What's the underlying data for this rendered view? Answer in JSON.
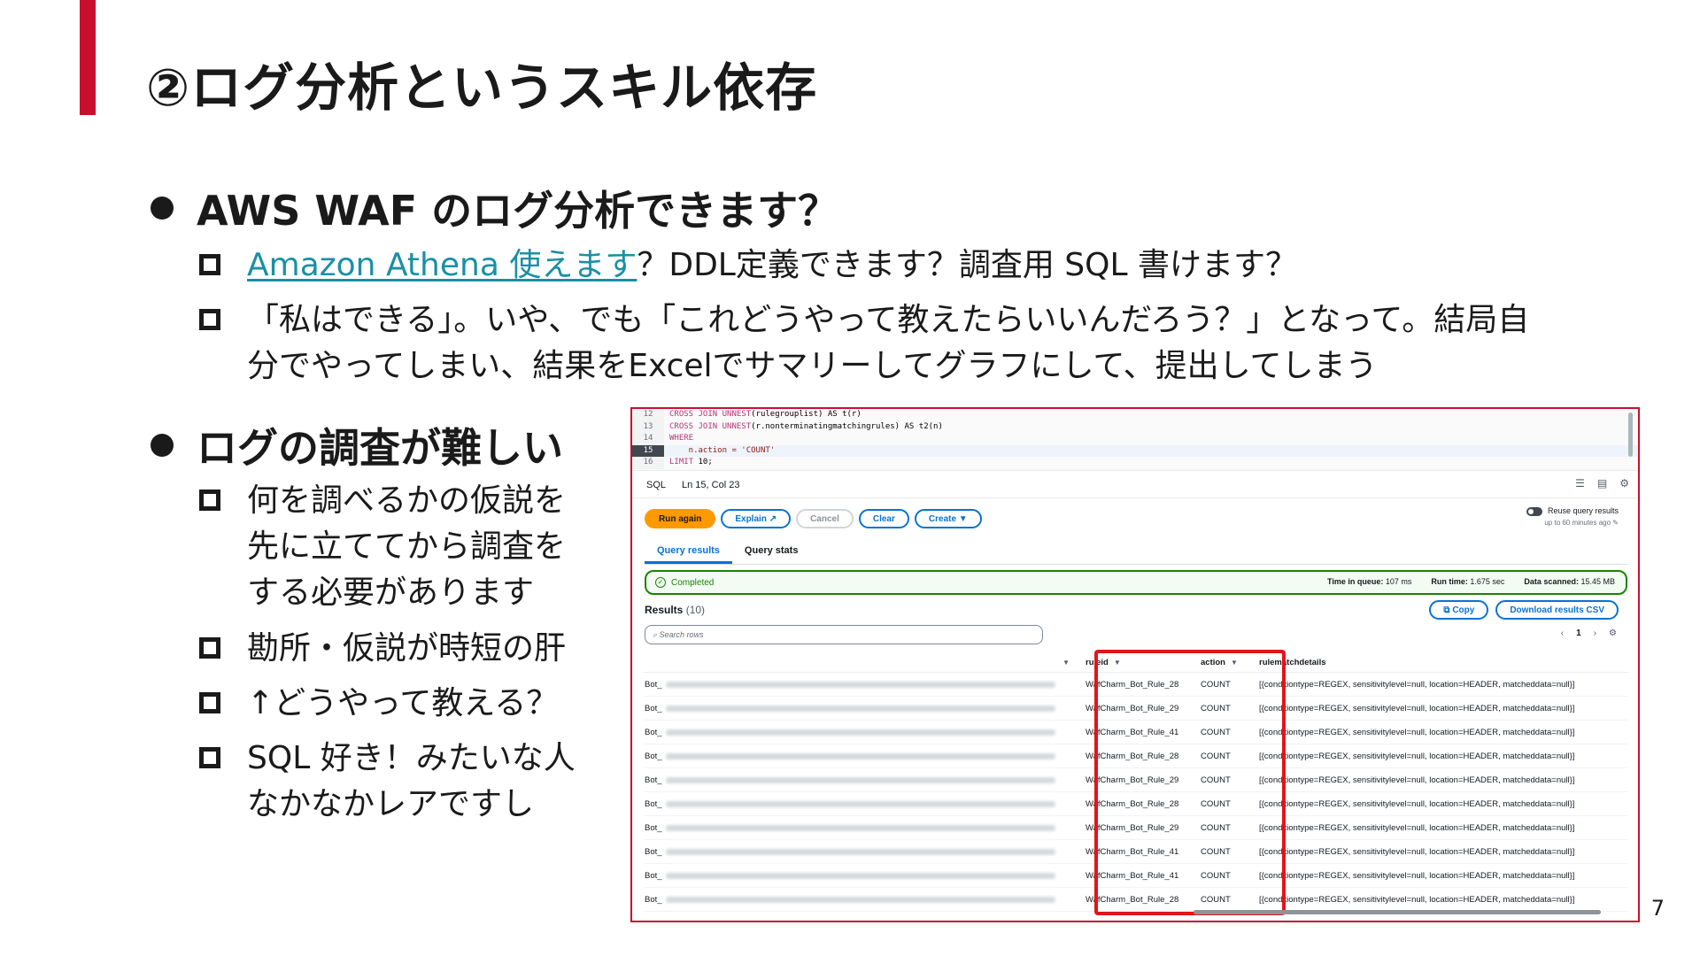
{
  "slide": {
    "title": "②ログ分析というスキル依存",
    "page_number": "7"
  },
  "bullets": [
    {
      "text": "AWS WAF のログ分析できます？",
      "subitems": [
        {
          "link": "Amazon Athena 使えます",
          "text": "？DDL定義できます？調査用 SQL 書けます？"
        },
        {
          "text": "「私はできる」。いや、でも「これどうやって教えたらいいんだろう？」となって。結局自\n分でやってしまい、結果をExcelでサマリーしてグラフにして、提出してしまう"
        }
      ]
    },
    {
      "text": "ログの調査が難しい",
      "subitems": [
        {
          "text": "何を調べるかの仮説を\n先に立ててから調査を\nする必要があります"
        },
        {
          "text": "勘所・仮説が時短の肝"
        },
        {
          "text": "↑どうやって教える？"
        },
        {
          "text": "SQL 好き！みたいな人\nなかなかレアですし"
        }
      ]
    }
  ],
  "console": {
    "sql_lines": [
      {
        "num": "12",
        "kw": "CROSS JOIN UNNEST",
        "rest": "(rulegrouplist) AS t(r)"
      },
      {
        "num": "13",
        "kw": "CROSS JOIN UNNEST",
        "rest": "(r.nonterminatingmatchingrules) AS t2(n)"
      },
      {
        "num": "14",
        "kw": "WHERE",
        "rest": ""
      },
      {
        "num": "15",
        "kw": "",
        "rest": "    n.action = 'COUNT'"
      },
      {
        "num": "16",
        "kw": "LIMIT",
        "rest": " 10;"
      }
    ],
    "status": {
      "lang": "SQL",
      "cursor": "Ln 15, Col 23"
    },
    "buttons": {
      "run_again": "Run again",
      "explain": "Explain ↗",
      "cancel": "Cancel",
      "clear": "Clear",
      "create": "Create ▼"
    },
    "reuse": {
      "label": "Reuse query results",
      "sub": "up to 60 minutes ago"
    },
    "tabs": [
      "Query results",
      "Query stats"
    ],
    "completed": {
      "label": "Completed",
      "time_in_queue_label": "Time in queue:",
      "time_in_queue": "107 ms",
      "run_time_label": "Run time:",
      "run_time": "1.675 sec",
      "data_scanned_label": "Data scanned:",
      "data_scanned": "15.45 MB"
    },
    "results": {
      "title": "Results",
      "count": "(10)",
      "copy": "Copy",
      "download": "Download results CSV",
      "search_placeholder": "Search rows",
      "page": "1"
    },
    "columns": [
      "ruleid",
      "action",
      "rulematchdetails"
    ],
    "row_prefix": "Bot_",
    "rows": [
      {
        "ruleid": "WafCharm_Bot_Rule_28",
        "action": "COUNT",
        "details": "[{conditiontype=REGEX, sensitivitylevel=null, location=HEADER, matcheddata=null}]"
      },
      {
        "ruleid": "WafCharm_Bot_Rule_29",
        "action": "COUNT",
        "details": "[{conditiontype=REGEX, sensitivitylevel=null, location=HEADER, matcheddata=null}]"
      },
      {
        "ruleid": "WafCharm_Bot_Rule_41",
        "action": "COUNT",
        "details": "[{conditiontype=REGEX, sensitivitylevel=null, location=HEADER, matcheddata=null}]"
      },
      {
        "ruleid": "WafCharm_Bot_Rule_28",
        "action": "COUNT",
        "details": "[{conditiontype=REGEX, sensitivitylevel=null, location=HEADER, matcheddata=null}]"
      },
      {
        "ruleid": "WafCharm_Bot_Rule_29",
        "action": "COUNT",
        "details": "[{conditiontype=REGEX, sensitivitylevel=null, location=HEADER, matcheddata=null}]"
      },
      {
        "ruleid": "WafCharm_Bot_Rule_28",
        "action": "COUNT",
        "details": "[{conditiontype=REGEX, sensitivitylevel=null, location=HEADER, matcheddata=null}]"
      },
      {
        "ruleid": "WafCharm_Bot_Rule_29",
        "action": "COUNT",
        "details": "[{conditiontype=REGEX, sensitivitylevel=null, location=HEADER, matcheddata=null}]"
      },
      {
        "ruleid": "WafCharm_Bot_Rule_41",
        "action": "COUNT",
        "details": "[{conditiontype=REGEX, sensitivitylevel=null, location=HEADER, matcheddata=null}]"
      },
      {
        "ruleid": "WafCharm_Bot_Rule_41",
        "action": "COUNT",
        "details": "[{conditiontype=REGEX, sensitivitylevel=null, location=HEADER, matcheddata=null}]"
      },
      {
        "ruleid": "WafCharm_Bot_Rule_28",
        "action": "COUNT",
        "details": "[{conditiontype=REGEX, sensitivitylevel=null, location=HEADER, matcheddata=null}]"
      }
    ]
  },
  "colors": {
    "accent": "#c8102e",
    "link": "#1a8fa6",
    "aws_orange": "#ff9900",
    "aws_blue": "#0972d3",
    "highlight": "#e1151a"
  }
}
